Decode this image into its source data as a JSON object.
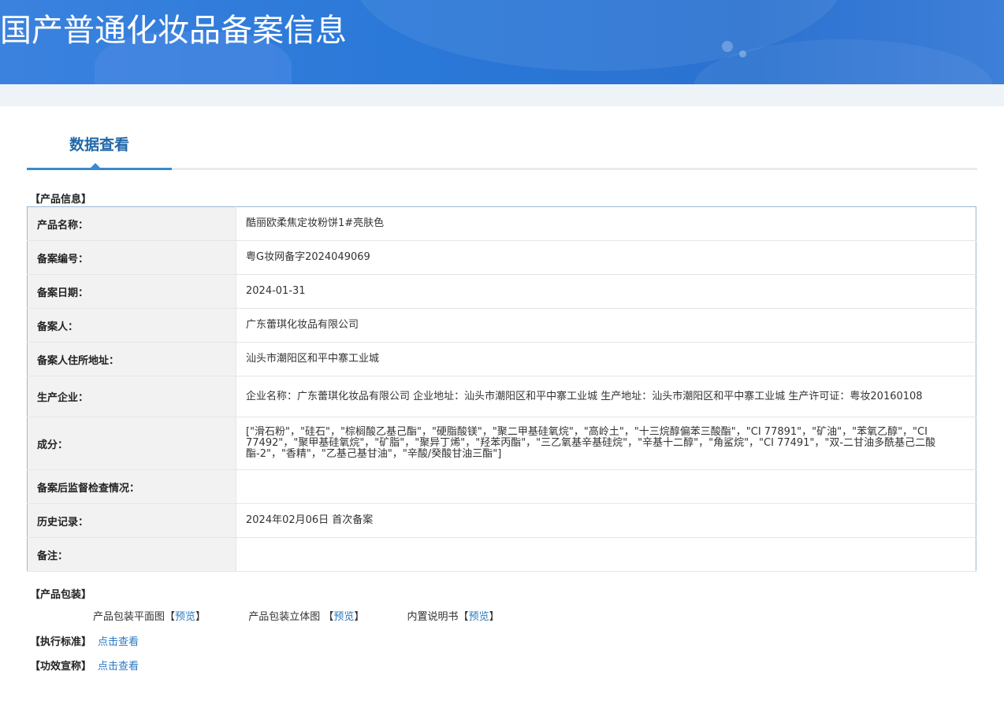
{
  "banner": {
    "title": "国产普通化妆品备案信息"
  },
  "tabs": {
    "active_label": "数据查看"
  },
  "product_info": {
    "section_title": "【产品信息】",
    "rows": [
      {
        "label": "产品名称：",
        "value": "酷丽欧柔焦定妆粉饼1#亮肤色"
      },
      {
        "label": "备案编号：",
        "value": "粤G妆网备字2024049069"
      },
      {
        "label": "备案日期：",
        "value": "2024-01-31"
      },
      {
        "label": "备案人：",
        "value": "广东蕾琪化妆品有限公司"
      },
      {
        "label": "备案人住所地址：",
        "value": "汕头市潮阳区和平中寨工业城"
      },
      {
        "label": "生产企业：",
        "value": "企业名称：广东蕾琪化妆品有限公司 企业地址：汕头市潮阳区和平中寨工业城 生产地址：汕头市潮阳区和平中寨工业城 生产许可证：粤妆20160108"
      },
      {
        "label": "成分：",
        "value": "[\"滑石粉\"，\"硅石\"，\"棕榈酸乙基己酯\"，\"硬脂酸镁\"，\"聚二甲基硅氧烷\"，\"高岭土\"，\"十三烷醇偏苯三酸酯\"，\"CI 77891\"，\"矿油\"，\"苯氧乙醇\"，\"CI 77492\"，\"聚甲基硅氧烷\"，\"矿脂\"，\"聚异丁烯\"，\"羟苯丙酯\"，\"三乙氧基辛基硅烷\"，\"辛基十二醇\"，\"角鲨烷\"，\"CI 77491\"，\"双-二甘油多酰基己二酸酯-2\"，\"香精\"，\"乙基己基甘油\"，\"辛酸/癸酸甘油三酯\"]"
      },
      {
        "label": "备案后监督检查情况：",
        "value": ""
      },
      {
        "label": "历史记录：",
        "value": "2024年02月06日 首次备案"
      },
      {
        "label": "备注：",
        "value": ""
      }
    ]
  },
  "packaging": {
    "section_title": "【产品包装】",
    "items": [
      {
        "label": "产品包装平面图",
        "bracket_open": "【",
        "link": "预览",
        "bracket_close": "】"
      },
      {
        "label": "产品包装立体图 ",
        "bracket_open": "【",
        "link": "预览",
        "bracket_close": "】"
      },
      {
        "label": "内置说明书",
        "bracket_open": "【",
        "link": "预览",
        "bracket_close": "】"
      }
    ]
  },
  "standard": {
    "label": "【执行标准】",
    "link": "点击查看"
  },
  "efficacy": {
    "label": "【功效宣称】",
    "link": "点击查看"
  }
}
